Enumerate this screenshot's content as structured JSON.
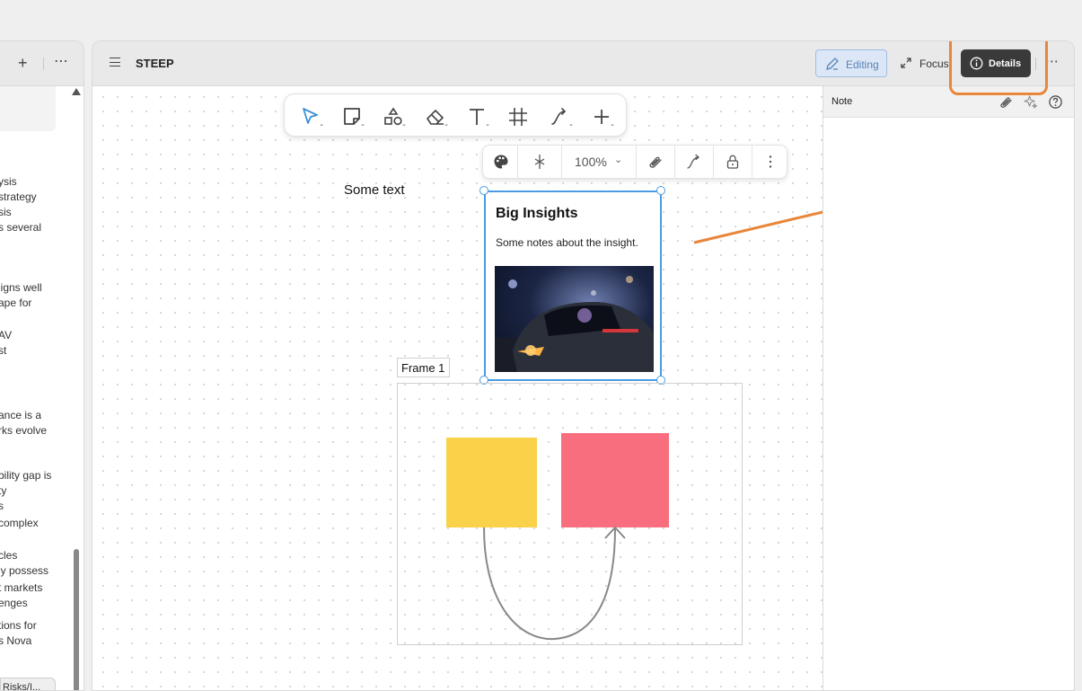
{
  "left_panel": {
    "add_icon": "plus-icon",
    "more_icon": "more-horizontal-icon",
    "lines": [
      "ysis",
      "strategy",
      "sis",
      "s several",
      "ligns well",
      "ape for",
      "AV",
      "st",
      "ance is a",
      "rks evolve",
      "bility gap is",
      "ty",
      "s",
      " complex",
      "cles",
      "ly possess",
      "t markets",
      "enges",
      "tions for",
      "s Nova"
    ],
    "tag": "Risks/I..."
  },
  "header": {
    "menu_icon": "hamburger-menu-icon",
    "title": "STEEP",
    "editing_label": "Editing",
    "focus_label": "Focus",
    "details_label": "Details",
    "more_icon": "more-horizontal-icon"
  },
  "toolbar": {
    "tools": [
      "select-tool",
      "note-tool",
      "shapes-tool",
      "eraser-tool",
      "text-tool",
      "frame-tool",
      "connector-tool",
      "add-tool"
    ]
  },
  "context_toolbar": {
    "zoom": "100%"
  },
  "canvas": {
    "free_text": "Some text",
    "card": {
      "title": "Big Insights",
      "body": "Some notes about the insight."
    },
    "frame_label": "Frame 1",
    "colors": {
      "yellow_note": "#fad24a",
      "red_note": "#f96e7e",
      "selection": "#4a9be3",
      "annotation": "#e8863a"
    }
  },
  "details_panel": {
    "title": "Note"
  }
}
